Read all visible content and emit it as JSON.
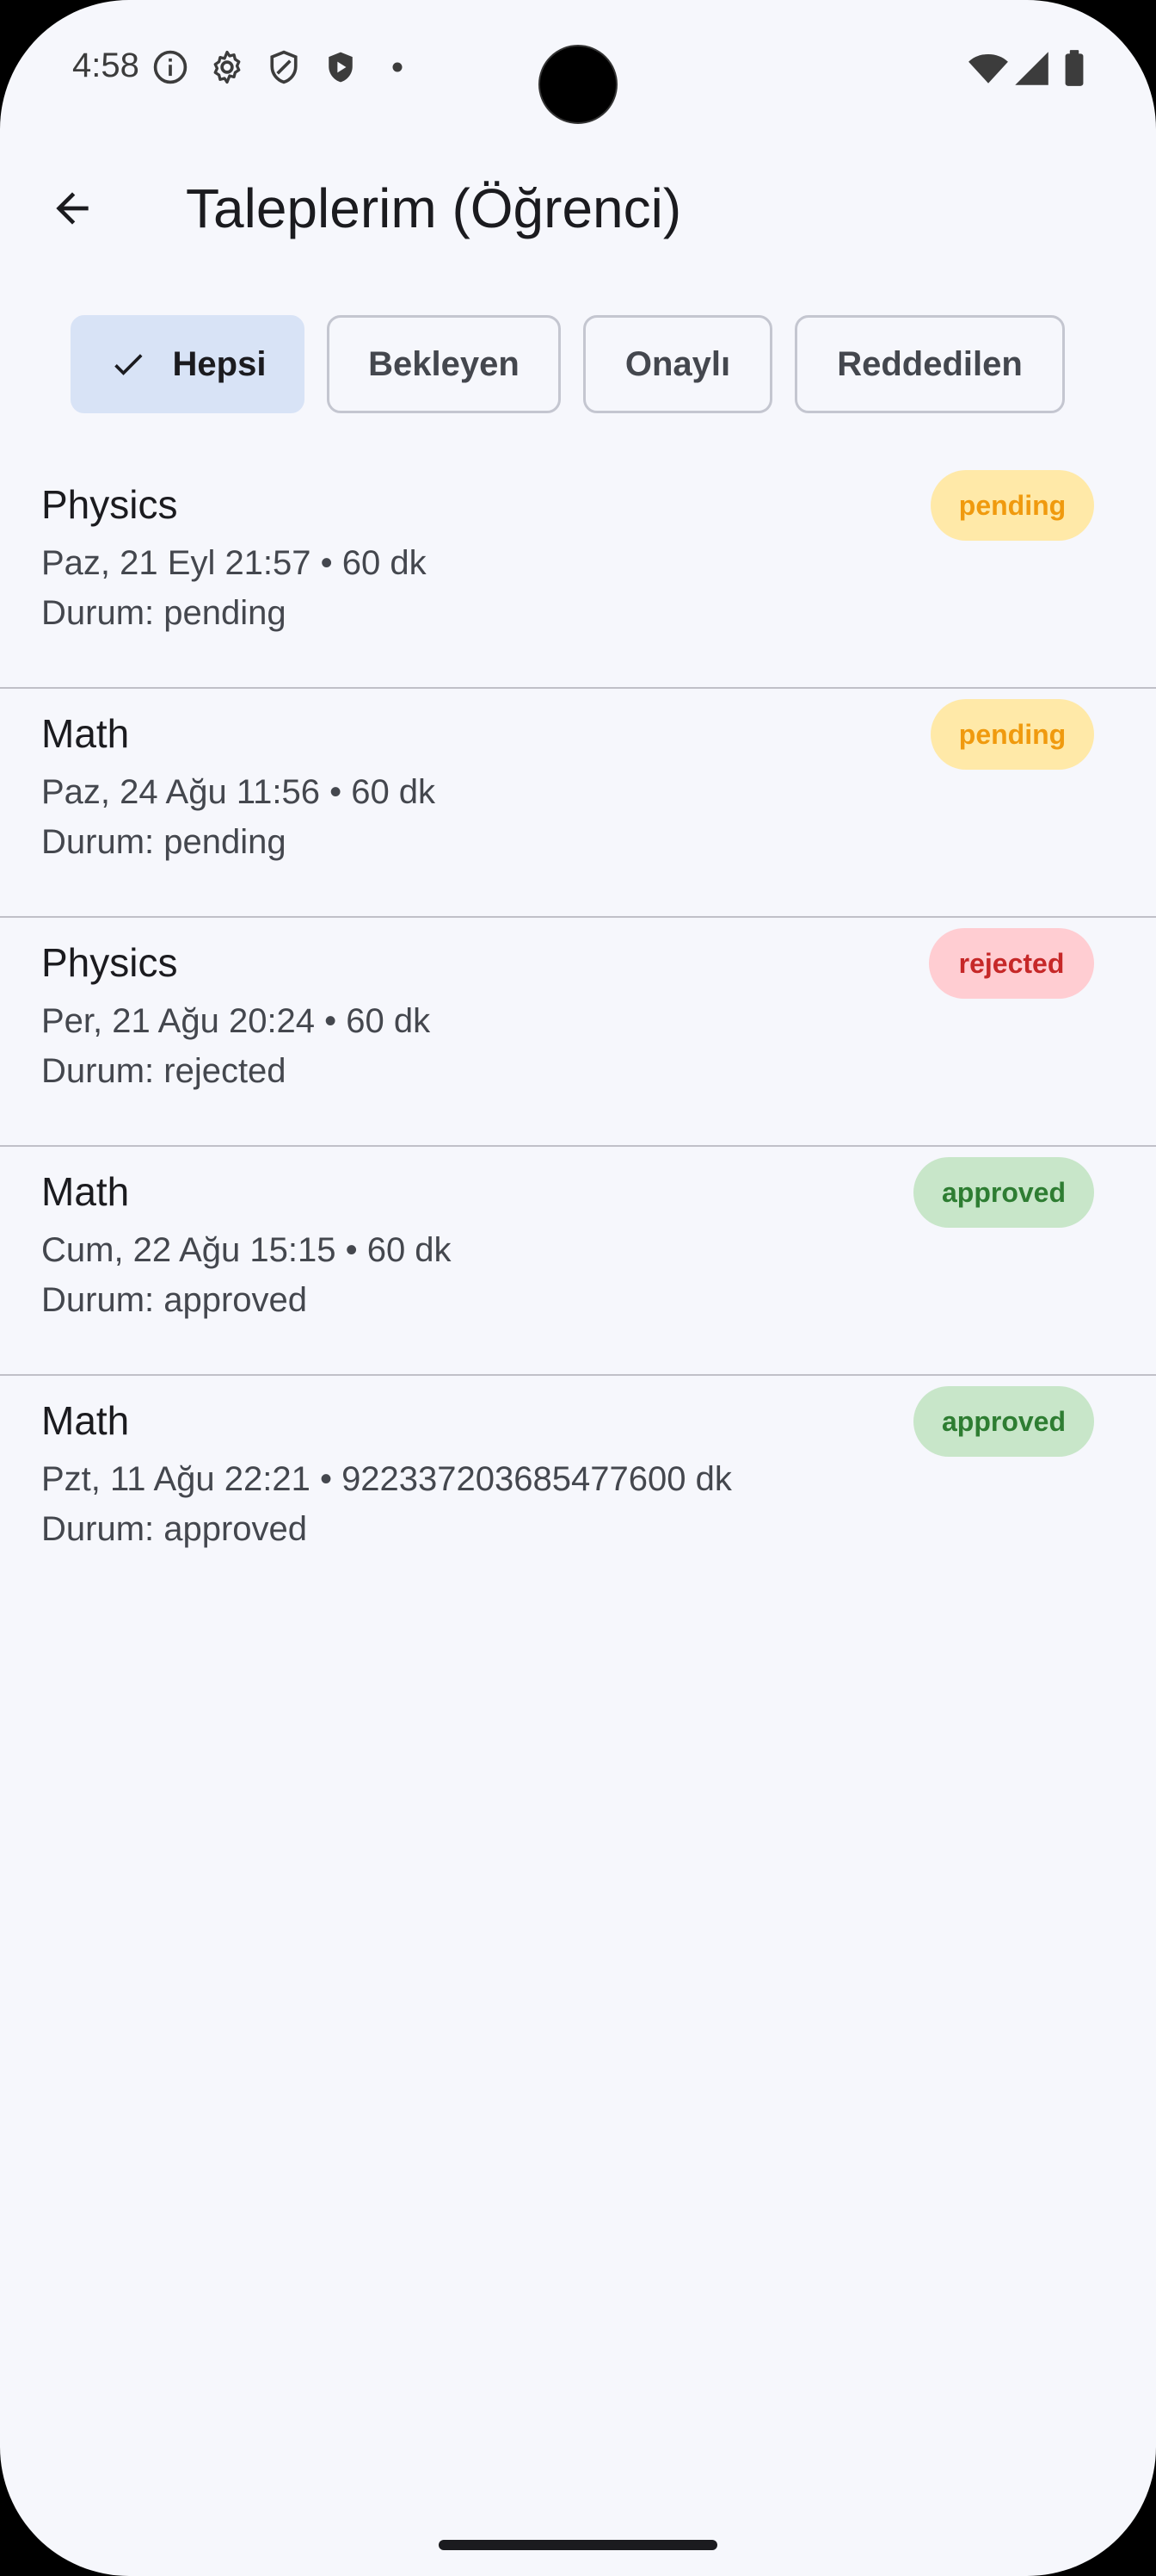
{
  "status_bar": {
    "time": "4:58",
    "left_icons": [
      "info-icon",
      "settings-icon",
      "shield-icon",
      "play-shield-icon",
      "dot-icon"
    ],
    "right_icons": [
      "wifi-icon",
      "signal-icon",
      "battery-icon"
    ]
  },
  "app_bar": {
    "back_icon": "arrow-back-icon",
    "title": "Taleplerim (Öğrenci)"
  },
  "filters": [
    {
      "label": "Hepsi",
      "selected": true
    },
    {
      "label": "Bekleyen",
      "selected": false
    },
    {
      "label": "Onaylı",
      "selected": false
    },
    {
      "label": "Reddedilen",
      "selected": false
    }
  ],
  "requests": [
    {
      "subject": "Physics",
      "details": "Paz, 21 Eyl 21:57 • 60 dk",
      "status_line": "Durum: pending",
      "badge": "pending",
      "badge_color": "#F09A0E"
    },
    {
      "subject": "Math",
      "details": "Paz, 24 Ağu 11:56 • 60 dk",
      "status_line": "Durum: pending",
      "badge": "pending",
      "badge_color": "#F09A0E"
    },
    {
      "subject": "Physics",
      "details": "Per, 21 Ağu 20:24 • 60 dk",
      "status_line": "Durum: rejected",
      "badge": "rejected",
      "badge_color": "#C62828"
    },
    {
      "subject": "Math",
      "details": "Cum, 22 Ağu 15:15 • 60 dk",
      "status_line": "Durum: approved",
      "badge": "approved",
      "badge_color": "#2E7D32"
    },
    {
      "subject": "Math",
      "details": "Pzt, 11 Ağu 22:21 • 922337203685477600 dk",
      "status_line": "Durum: approved",
      "badge": "approved",
      "badge_color": "#2E7D32"
    }
  ],
  "colors": {
    "background": "#F6F7FC",
    "selected_chip": "#D8E3F6"
  }
}
